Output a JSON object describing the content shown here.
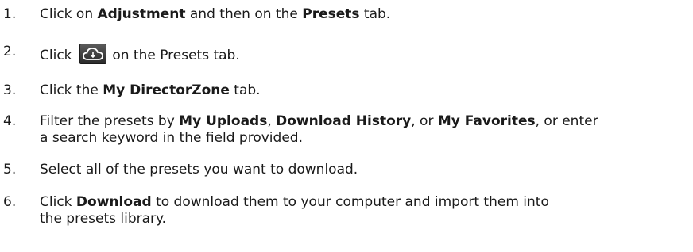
{
  "steps": [
    {
      "num": "1.",
      "parts": [
        "Click on ",
        "Adjustment",
        " and then on the ",
        "Presets",
        " tab."
      ]
    },
    {
      "num": "2.",
      "parts": [
        "Click ",
        " on the Presets tab."
      ],
      "icon": "cloud-download-icon"
    },
    {
      "num": "3.",
      "parts": [
        "Click the ",
        "My DirectorZone",
        " tab."
      ]
    },
    {
      "num": "4.",
      "parts": [
        "Filter the presets by ",
        "My Uploads",
        ", ",
        "Download History",
        ", or ",
        "My Favorites",
        ", or enter",
        "a search keyword in the field provided."
      ]
    },
    {
      "num": "5.",
      "parts": [
        "Select all of the presets you want to download."
      ]
    },
    {
      "num": "6.",
      "parts": [
        "Click ",
        "Download",
        " to download them to your computer and import them into",
        "the presets library."
      ]
    }
  ]
}
